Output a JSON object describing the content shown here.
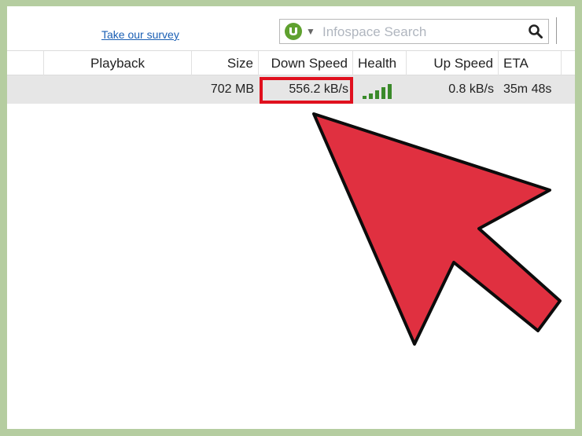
{
  "toolbar": {
    "survey_link": "Take our survey",
    "search_placeholder": "Infospace Search",
    "icons": [
      "utorrent-icon",
      "chevron-down-icon",
      "search-icon"
    ]
  },
  "table": {
    "columns": [
      "Playback",
      "Size",
      "Down Speed",
      "Health",
      "Up Speed",
      "ETA"
    ],
    "rows": [
      {
        "playback": "",
        "size": "702 MB",
        "down_speed": "556.2 kB/s",
        "health_bars": 5,
        "up_speed": "0.8 kB/s",
        "eta": "35m 48s"
      }
    ]
  },
  "colors": {
    "highlight": "#e0101e",
    "pointer_arrow": "#e03040",
    "health": "#3a8a2a",
    "utorrent": "#5fa12f",
    "frame_border": "#b5cda0"
  }
}
